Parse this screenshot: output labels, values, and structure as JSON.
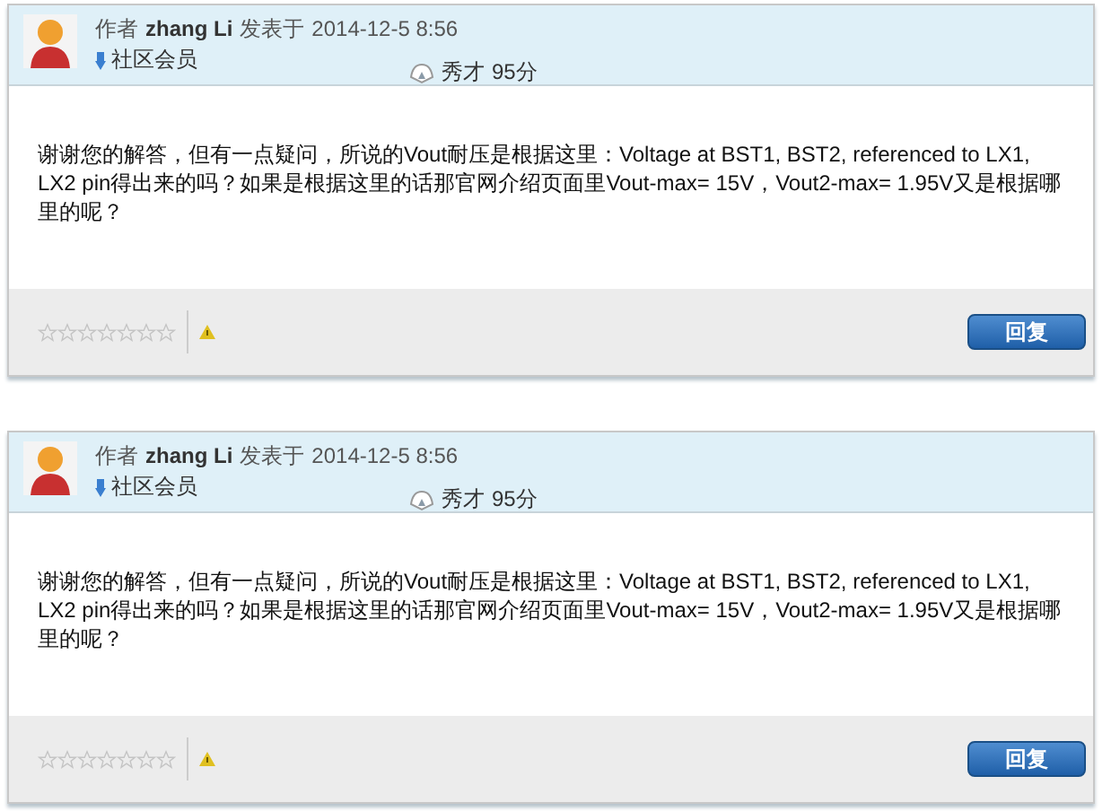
{
  "posts": [
    {
      "author_prefix": "作者",
      "author": "zhang Li",
      "posted_label": "发表于",
      "date": "2014-12-5 8:56",
      "role": "社区会员",
      "rank": "秀才",
      "score": "95分",
      "body": "谢谢您的解答，但有一点疑问，所说的Vout耐压是根据这里：Voltage at BST1, BST2, referenced to LX1, LX2 pin得出来的吗？如果是根据这里的话那官网介绍页面里Vout-max= 15V，Vout2-max= 1.95V又是根据哪里的呢？",
      "stars": 0,
      "reply_button": "回复"
    },
    {
      "author_prefix": "作者",
      "author": "zhang Li",
      "posted_label": "发表于",
      "date": "2014-12-5 8:56",
      "role": "社区会员",
      "rank": "秀才",
      "score": "95分",
      "body": "谢谢您的解答，但有一点疑问，所说的Vout耐压是根据这里：Voltage at BST1, BST2, referenced to LX1, LX2 pin得出来的吗？如果是根据这里的话那官网介绍页面里Vout-max= 15V，Vout2-max= 1.95V又是根据哪里的呢？",
      "stars": 0,
      "reply_button": "回复"
    }
  ]
}
